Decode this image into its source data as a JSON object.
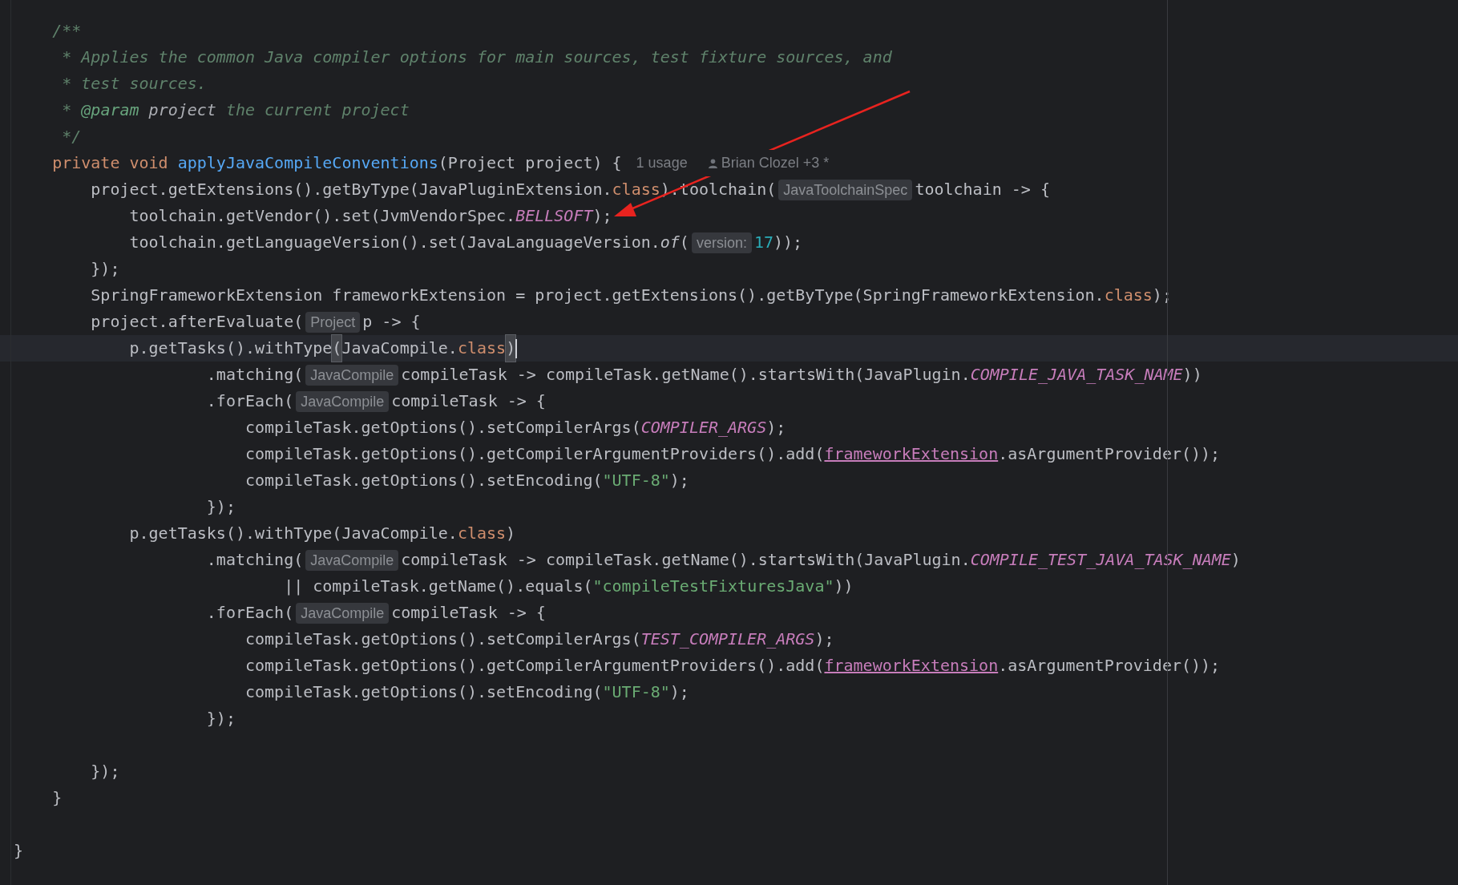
{
  "editor": {
    "lines": [
      {
        "current": false,
        "tokens": [
          {
            "kind": "comment",
            "text": "    /**"
          }
        ]
      },
      {
        "current": false,
        "tokens": [
          {
            "kind": "comment",
            "text": "     * Applies the common Java compiler options for main sources, test fixture sources, and"
          }
        ]
      },
      {
        "current": false,
        "tokens": [
          {
            "kind": "comment",
            "text": "     * test sources."
          }
        ]
      },
      {
        "current": false,
        "tokens": [
          {
            "kind": "comment",
            "text": "     * "
          },
          {
            "kind": "doc-tag",
            "text": "@param"
          },
          {
            "kind": "doc-param",
            "text": " project"
          },
          {
            "kind": "comment",
            "text": " the current project"
          }
        ]
      },
      {
        "current": false,
        "tokens": [
          {
            "kind": "comment",
            "text": "     */"
          }
        ]
      },
      {
        "current": false,
        "tokens": [
          {
            "kind": "keyword",
            "text": "    private void "
          },
          {
            "kind": "declaration",
            "text": "applyJavaCompileConventions"
          },
          {
            "kind": "plain",
            "text": "(Project project) {"
          },
          {
            "kind": "usage",
            "text": "1 usage"
          },
          {
            "kind": "author",
            "text": "Brian Clozel +3 *"
          }
        ]
      },
      {
        "current": false,
        "tokens": [
          {
            "kind": "plain",
            "text": "        project.getExtensions().getByType(JavaPluginExtension."
          },
          {
            "kind": "keyword",
            "text": "class"
          },
          {
            "kind": "plain",
            "text": ").toolchain("
          },
          {
            "kind": "hint",
            "text": "JavaToolchainSpec"
          },
          {
            "kind": "plain",
            "text": "toolchain -> {"
          }
        ]
      },
      {
        "current": false,
        "tokens": [
          {
            "kind": "plain",
            "text": "            toolchain.getVendor().set(JvmVendorSpec."
          },
          {
            "kind": "constant",
            "text": "BELLSOFT"
          },
          {
            "kind": "plain",
            "text": ");"
          }
        ]
      },
      {
        "current": false,
        "tokens": [
          {
            "kind": "plain",
            "text": "            toolchain.getLanguageVersion().set(JavaLanguageVersion."
          },
          {
            "kind": "static-call",
            "text": "of"
          },
          {
            "kind": "plain",
            "text": "("
          },
          {
            "kind": "hint",
            "text": "version:"
          },
          {
            "kind": "number",
            "text": "17"
          },
          {
            "kind": "plain",
            "text": "));"
          }
        ]
      },
      {
        "current": false,
        "tokens": [
          {
            "kind": "plain",
            "text": "        });"
          }
        ]
      },
      {
        "current": false,
        "tokens": [
          {
            "kind": "plain",
            "text": "        SpringFrameworkExtension frameworkExtension = project.getExtensions().getByType(SpringFrameworkExtension."
          },
          {
            "kind": "keyword",
            "text": "class"
          },
          {
            "kind": "plain",
            "text": ");"
          }
        ]
      },
      {
        "current": false,
        "tokens": [
          {
            "kind": "plain",
            "text": "        project.afterEvaluate("
          },
          {
            "kind": "hint",
            "text": "Project"
          },
          {
            "kind": "plain",
            "text": "p -> {"
          }
        ]
      },
      {
        "current": true,
        "tokens": [
          {
            "kind": "plain",
            "text": "            p.getTasks().withType"
          },
          {
            "kind": "bracket-match",
            "text": "("
          },
          {
            "kind": "plain",
            "text": "JavaCompile."
          },
          {
            "kind": "keyword",
            "text": "class"
          },
          {
            "kind": "bracket-match",
            "text": ")"
          }
        ]
      },
      {
        "current": false,
        "tokens": [
          {
            "kind": "plain",
            "text": "                    .matching("
          },
          {
            "kind": "hint",
            "text": "JavaCompile"
          },
          {
            "kind": "plain",
            "text": "compileTask -> compileTask.getName().startsWith(JavaPlugin."
          },
          {
            "kind": "constant",
            "text": "COMPILE_JAVA_TASK_NAME"
          },
          {
            "kind": "plain",
            "text": "))"
          }
        ]
      },
      {
        "current": false,
        "tokens": [
          {
            "kind": "plain",
            "text": "                    .forEach("
          },
          {
            "kind": "hint",
            "text": "JavaCompile"
          },
          {
            "kind": "plain",
            "text": "compileTask -> {"
          }
        ]
      },
      {
        "current": false,
        "tokens": [
          {
            "kind": "plain",
            "text": "                        compileTask.getOptions().setCompilerArgs("
          },
          {
            "kind": "constant",
            "text": "COMPILER_ARGS"
          },
          {
            "kind": "plain",
            "text": ");"
          }
        ]
      },
      {
        "current": false,
        "tokens": [
          {
            "kind": "plain",
            "text": "                        compileTask.getOptions().getCompilerArgumentProviders().add("
          },
          {
            "kind": "field",
            "text": "frameworkExtension"
          },
          {
            "kind": "plain",
            "text": ".asArgumentProvider());"
          }
        ]
      },
      {
        "current": false,
        "tokens": [
          {
            "kind": "plain",
            "text": "                        compileTask.getOptions().setEncoding("
          },
          {
            "kind": "string",
            "text": "\"UTF-8\""
          },
          {
            "kind": "plain",
            "text": ");"
          }
        ]
      },
      {
        "current": false,
        "tokens": [
          {
            "kind": "plain",
            "text": "                    });"
          }
        ]
      },
      {
        "current": false,
        "tokens": [
          {
            "kind": "plain",
            "text": "            p.getTasks().withType(JavaCompile."
          },
          {
            "kind": "keyword",
            "text": "class"
          },
          {
            "kind": "plain",
            "text": ")"
          }
        ]
      },
      {
        "current": false,
        "tokens": [
          {
            "kind": "plain",
            "text": "                    .matching("
          },
          {
            "kind": "hint",
            "text": "JavaCompile"
          },
          {
            "kind": "plain",
            "text": "compileTask -> compileTask.getName().startsWith(JavaPlugin."
          },
          {
            "kind": "constant",
            "text": "COMPILE_TEST_JAVA_TASK_NAME"
          },
          {
            "kind": "plain",
            "text": ")"
          }
        ]
      },
      {
        "current": false,
        "tokens": [
          {
            "kind": "plain",
            "text": "                            || compileTask.getName().equals("
          },
          {
            "kind": "string",
            "text": "\"compileTestFixturesJava\""
          },
          {
            "kind": "plain",
            "text": "))"
          }
        ]
      },
      {
        "current": false,
        "tokens": [
          {
            "kind": "plain",
            "text": "                    .forEach("
          },
          {
            "kind": "hint",
            "text": "JavaCompile"
          },
          {
            "kind": "plain",
            "text": "compileTask -> {"
          }
        ]
      },
      {
        "current": false,
        "tokens": [
          {
            "kind": "plain",
            "text": "                        compileTask.getOptions().setCompilerArgs("
          },
          {
            "kind": "constant",
            "text": "TEST_COMPILER_ARGS"
          },
          {
            "kind": "plain",
            "text": ");"
          }
        ]
      },
      {
        "current": false,
        "tokens": [
          {
            "kind": "plain",
            "text": "                        compileTask.getOptions().getCompilerArgumentProviders().add("
          },
          {
            "kind": "field",
            "text": "frameworkExtension"
          },
          {
            "kind": "plain",
            "text": ".asArgumentProvider());"
          }
        ]
      },
      {
        "current": false,
        "tokens": [
          {
            "kind": "plain",
            "text": "                        compileTask.getOptions().setEncoding("
          },
          {
            "kind": "string",
            "text": "\"UTF-8\""
          },
          {
            "kind": "plain",
            "text": ");"
          }
        ]
      },
      {
        "current": false,
        "tokens": [
          {
            "kind": "plain",
            "text": "                    });"
          }
        ]
      },
      {
        "current": false
      },
      {
        "current": false,
        "tokens": [
          {
            "kind": "plain",
            "text": "        });"
          }
        ]
      },
      {
        "current": false,
        "tokens": [
          {
            "kind": "plain",
            "text": "    }"
          }
        ]
      },
      {
        "current": false
      },
      {
        "current": false,
        "tokens": [
          {
            "kind": "plain",
            "text": "}"
          }
        ]
      }
    ]
  }
}
